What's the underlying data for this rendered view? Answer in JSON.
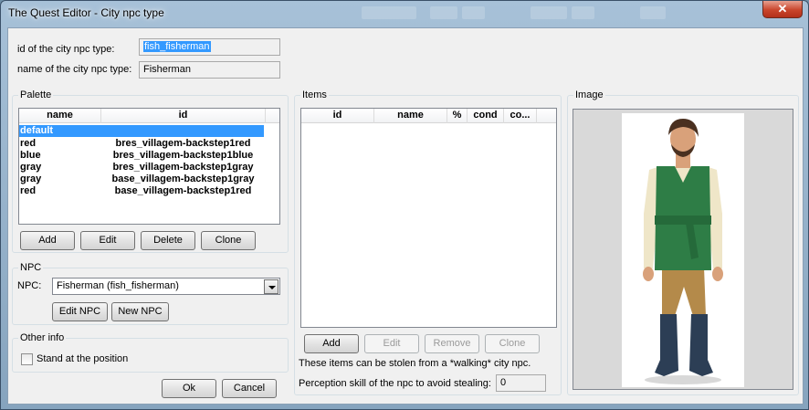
{
  "window": {
    "title": "The Quest Editor - City npc type",
    "close_glyph": "✕"
  },
  "fields": {
    "id_label": "id of the city npc type:",
    "id_value": "fish_fisherman",
    "name_label": "name of the city npc type:",
    "name_value": "Fisherman"
  },
  "palette": {
    "group_title": "Palette",
    "columns": [
      "name",
      "id"
    ],
    "rows": [
      {
        "name": "default",
        "id": ""
      },
      {
        "name": "red",
        "id": "bres_villagem-backstep1red"
      },
      {
        "name": "blue",
        "id": "bres_villagem-backstep1blue"
      },
      {
        "name": "gray",
        "id": "bres_villagem-backstep1gray"
      },
      {
        "name": "gray",
        "id": "base_villagem-backstep1gray"
      },
      {
        "name": "red",
        "id": "base_villagem-backstep1red"
      }
    ],
    "selected_index": 0,
    "buttons": {
      "add": "Add",
      "edit": "Edit",
      "delete": "Delete",
      "clone": "Clone"
    }
  },
  "npc": {
    "group_title": "NPC",
    "label": "NPC:",
    "selected": "Fisherman (fish_fisherman)",
    "buttons": {
      "edit": "Edit NPC",
      "new": "New NPC"
    }
  },
  "other_info": {
    "group_title": "Other info",
    "checkbox_label": "Stand at the position",
    "checked": false
  },
  "dialog_buttons": {
    "ok": "Ok",
    "cancel": "Cancel"
  },
  "items": {
    "group_title": "Items",
    "columns": [
      "id",
      "name",
      "%",
      "cond",
      "co..."
    ],
    "buttons": {
      "add": "Add",
      "edit": "Edit",
      "remove": "Remove",
      "clone": "Clone"
    },
    "note": "These items can be stolen from a *walking* city npc.",
    "perception_label": "Perception skill of the npc to avoid stealing:",
    "perception_value": "0"
  },
  "image": {
    "group_title": "Image",
    "description": "fisherman-portrait"
  },
  "colors": {
    "selection": "#3399ff",
    "shirt": "#2e7d46",
    "close": "#c9452c"
  }
}
